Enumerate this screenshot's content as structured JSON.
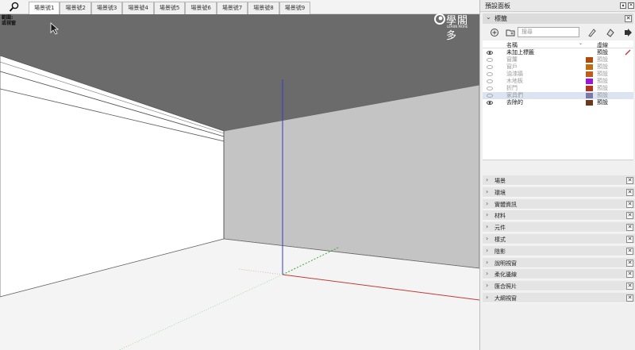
{
  "toolbar": {
    "scene_tabs": [
      "場景號1",
      "場景號2",
      "場景號3",
      "場景號4",
      "場景號5",
      "場景號6",
      "場景號7",
      "場景號8",
      "場景號9"
    ],
    "active_tab_index": 0,
    "tool_tip_line1": "範圍:",
    "tool_tip_line2": "或視窗"
  },
  "logo": {
    "text": "學閣多",
    "sub": "LEARN MORE"
  },
  "panel": {
    "title": "預設面板",
    "tags": {
      "header": "標籤",
      "search_placeholder": "搜尋",
      "col_name": "名稱",
      "col_line": "虛線",
      "rows": [
        {
          "name": "未加上標籤",
          "color": "",
          "style": "預設",
          "visible": true,
          "selected": false
        },
        {
          "name": "窗簾",
          "color": "#b04a08",
          "style": "預設",
          "visible": false,
          "selected": false
        },
        {
          "name": "窗戶",
          "color": "#c46a10",
          "style": "預設",
          "visible": false,
          "selected": false
        },
        {
          "name": "油漆牆",
          "color": "#c45a16",
          "style": "預設",
          "visible": false,
          "selected": false
        },
        {
          "name": "木地板",
          "color": "#9b16d8",
          "style": "預設",
          "visible": false,
          "selected": false
        },
        {
          "name": "折門",
          "color": "#b4331a",
          "style": "預設",
          "visible": false,
          "selected": false
        },
        {
          "name": "家具們",
          "color": "#7a7aa8",
          "style": "預設",
          "visible": false,
          "selected": true
        },
        {
          "name": "去除的",
          "color": "#6b3a1c",
          "style": "預設",
          "visible": true,
          "selected": false
        }
      ]
    },
    "sections": [
      "場景",
      "環境",
      "實體資訊",
      "材料",
      "元件",
      "樣式",
      "陰影",
      "說明視窗",
      "柔化邊線",
      "匯合照片",
      "大綱視窗"
    ]
  },
  "colors": {
    "ceiling": "#6b6b6b",
    "back_wall": "#c4c4c4",
    "floor": "#f4f4f4",
    "blue_axis": "#3a3ac8",
    "red_axis": "#c23a3a",
    "green_axis": "#3aa83a"
  }
}
